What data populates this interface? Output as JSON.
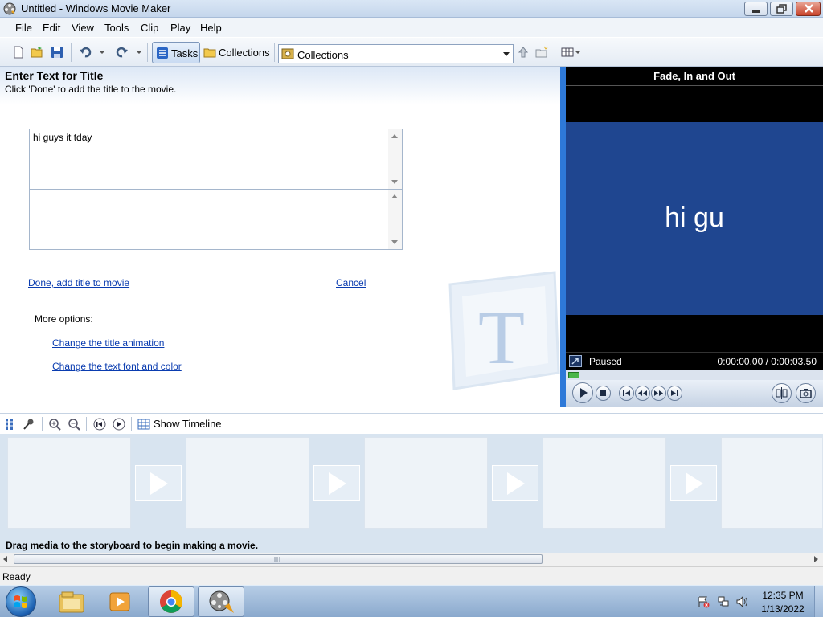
{
  "window": {
    "title": "Untitled - Windows Movie Maker"
  },
  "menu": {
    "items": [
      "File",
      "Edit",
      "View",
      "Tools",
      "Clip",
      "Play",
      "Help"
    ]
  },
  "toolbar": {
    "tasks_label": "Tasks",
    "collections_label": "Collections",
    "collections_select_value": "Collections"
  },
  "task_pane": {
    "title": "Enter Text for Title",
    "subtitle": "Click 'Done' to add the title to the movie.",
    "title_text_value": "hi guys it tday",
    "subtitle_text_value": "",
    "done_link": "Done, add title to movie",
    "cancel_link": "Cancel",
    "more_options_label": "More options:",
    "change_animation_link": "Change the title animation",
    "change_font_link": "Change the text font and color"
  },
  "preview": {
    "title": "Fade, In and Out",
    "screen_text": "hi gu",
    "status": "Paused",
    "time": "0:00:00.00 / 0:00:03.50",
    "progress_fraction": 0.0,
    "screen_color": "#1f4690"
  },
  "storyboard": {
    "show_timeline_label": "Show Timeline",
    "hint": "Drag media to the storyboard to begin making a movie."
  },
  "statusbar": {
    "text": "Ready"
  },
  "taskbar": {
    "time": "12:35 PM",
    "date": "1/13/2022"
  },
  "colors": {
    "accent": "#2e79d8",
    "link": "#0a3cb0"
  }
}
